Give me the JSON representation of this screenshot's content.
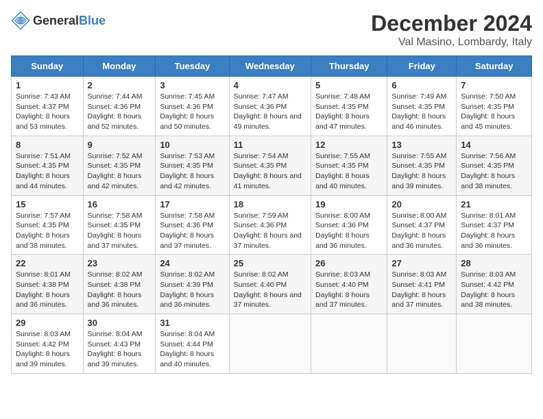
{
  "header": {
    "logo_general": "General",
    "logo_blue": "Blue",
    "title": "December 2024",
    "subtitle": "Val Masino, Lombardy, Italy"
  },
  "calendar": {
    "days_of_week": [
      "Sunday",
      "Monday",
      "Tuesday",
      "Wednesday",
      "Thursday",
      "Friday",
      "Saturday"
    ],
    "weeks": [
      [
        {
          "day": "1",
          "sunrise": "Sunrise: 7:43 AM",
          "sunset": "Sunset: 4:37 PM",
          "daylight": "Daylight: 8 hours and 53 minutes."
        },
        {
          "day": "2",
          "sunrise": "Sunrise: 7:44 AM",
          "sunset": "Sunset: 4:36 PM",
          "daylight": "Daylight: 8 hours and 52 minutes."
        },
        {
          "day": "3",
          "sunrise": "Sunrise: 7:45 AM",
          "sunset": "Sunset: 4:36 PM",
          "daylight": "Daylight: 8 hours and 50 minutes."
        },
        {
          "day": "4",
          "sunrise": "Sunrise: 7:47 AM",
          "sunset": "Sunset: 4:36 PM",
          "daylight": "Daylight: 8 hours and 49 minutes."
        },
        {
          "day": "5",
          "sunrise": "Sunrise: 7:48 AM",
          "sunset": "Sunset: 4:35 PM",
          "daylight": "Daylight: 8 hours and 47 minutes."
        },
        {
          "day": "6",
          "sunrise": "Sunrise: 7:49 AM",
          "sunset": "Sunset: 4:35 PM",
          "daylight": "Daylight: 8 hours and 46 minutes."
        },
        {
          "day": "7",
          "sunrise": "Sunrise: 7:50 AM",
          "sunset": "Sunset: 4:35 PM",
          "daylight": "Daylight: 8 hours and 45 minutes."
        }
      ],
      [
        {
          "day": "8",
          "sunrise": "Sunrise: 7:51 AM",
          "sunset": "Sunset: 4:35 PM",
          "daylight": "Daylight: 8 hours and 44 minutes."
        },
        {
          "day": "9",
          "sunrise": "Sunrise: 7:52 AM",
          "sunset": "Sunset: 4:35 PM",
          "daylight": "Daylight: 8 hours and 42 minutes."
        },
        {
          "day": "10",
          "sunrise": "Sunrise: 7:53 AM",
          "sunset": "Sunset: 4:35 PM",
          "daylight": "Daylight: 8 hours and 42 minutes."
        },
        {
          "day": "11",
          "sunrise": "Sunrise: 7:54 AM",
          "sunset": "Sunset: 4:35 PM",
          "daylight": "Daylight: 8 hours and 41 minutes."
        },
        {
          "day": "12",
          "sunrise": "Sunrise: 7:55 AM",
          "sunset": "Sunset: 4:35 PM",
          "daylight": "Daylight: 8 hours and 40 minutes."
        },
        {
          "day": "13",
          "sunrise": "Sunrise: 7:55 AM",
          "sunset": "Sunset: 4:35 PM",
          "daylight": "Daylight: 8 hours and 39 minutes."
        },
        {
          "day": "14",
          "sunrise": "Sunrise: 7:56 AM",
          "sunset": "Sunset: 4:35 PM",
          "daylight": "Daylight: 8 hours and 38 minutes."
        }
      ],
      [
        {
          "day": "15",
          "sunrise": "Sunrise: 7:57 AM",
          "sunset": "Sunset: 4:35 PM",
          "daylight": "Daylight: 8 hours and 38 minutes."
        },
        {
          "day": "16",
          "sunrise": "Sunrise: 7:58 AM",
          "sunset": "Sunset: 4:35 PM",
          "daylight": "Daylight: 8 hours and 37 minutes."
        },
        {
          "day": "17",
          "sunrise": "Sunrise: 7:58 AM",
          "sunset": "Sunset: 4:36 PM",
          "daylight": "Daylight: 8 hours and 37 minutes."
        },
        {
          "day": "18",
          "sunrise": "Sunrise: 7:59 AM",
          "sunset": "Sunset: 4:36 PM",
          "daylight": "Daylight: 8 hours and 37 minutes."
        },
        {
          "day": "19",
          "sunrise": "Sunrise: 8:00 AM",
          "sunset": "Sunset: 4:36 PM",
          "daylight": "Daylight: 8 hours and 36 minutes."
        },
        {
          "day": "20",
          "sunrise": "Sunrise: 8:00 AM",
          "sunset": "Sunset: 4:37 PM",
          "daylight": "Daylight: 8 hours and 36 minutes."
        },
        {
          "day": "21",
          "sunrise": "Sunrise: 8:01 AM",
          "sunset": "Sunset: 4:37 PM",
          "daylight": "Daylight: 8 hours and 36 minutes."
        }
      ],
      [
        {
          "day": "22",
          "sunrise": "Sunrise: 8:01 AM",
          "sunset": "Sunset: 4:38 PM",
          "daylight": "Daylight: 8 hours and 36 minutes."
        },
        {
          "day": "23",
          "sunrise": "Sunrise: 8:02 AM",
          "sunset": "Sunset: 4:38 PM",
          "daylight": "Daylight: 8 hours and 36 minutes."
        },
        {
          "day": "24",
          "sunrise": "Sunrise: 8:02 AM",
          "sunset": "Sunset: 4:39 PM",
          "daylight": "Daylight: 8 hours and 36 minutes."
        },
        {
          "day": "25",
          "sunrise": "Sunrise: 8:02 AM",
          "sunset": "Sunset: 4:40 PM",
          "daylight": "Daylight: 8 hours and 37 minutes."
        },
        {
          "day": "26",
          "sunrise": "Sunrise: 8:03 AM",
          "sunset": "Sunset: 4:40 PM",
          "daylight": "Daylight: 8 hours and 37 minutes."
        },
        {
          "day": "27",
          "sunrise": "Sunrise: 8:03 AM",
          "sunset": "Sunset: 4:41 PM",
          "daylight": "Daylight: 8 hours and 37 minutes."
        },
        {
          "day": "28",
          "sunrise": "Sunrise: 8:03 AM",
          "sunset": "Sunset: 4:42 PM",
          "daylight": "Daylight: 8 hours and 38 minutes."
        }
      ],
      [
        {
          "day": "29",
          "sunrise": "Sunrise: 8:03 AM",
          "sunset": "Sunset: 4:42 PM",
          "daylight": "Daylight: 8 hours and 39 minutes."
        },
        {
          "day": "30",
          "sunrise": "Sunrise: 8:04 AM",
          "sunset": "Sunset: 4:43 PM",
          "daylight": "Daylight: 8 hours and 39 minutes."
        },
        {
          "day": "31",
          "sunrise": "Sunrise: 8:04 AM",
          "sunset": "Sunset: 4:44 PM",
          "daylight": "Daylight: 8 hours and 40 minutes."
        },
        null,
        null,
        null,
        null
      ]
    ]
  }
}
